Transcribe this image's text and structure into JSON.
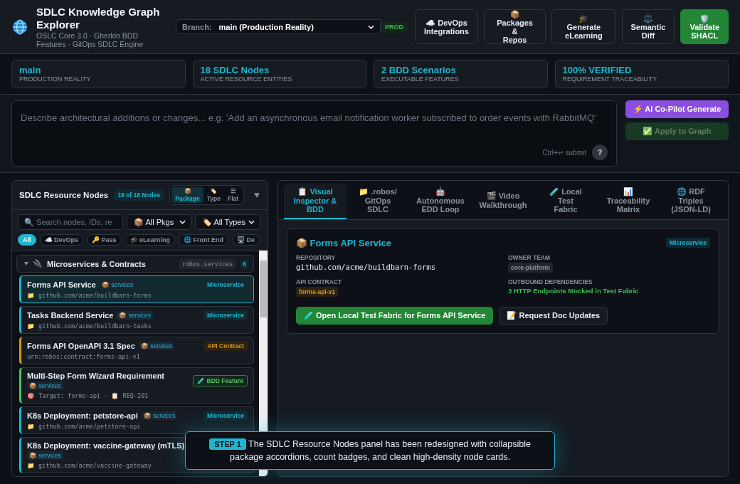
{
  "header": {
    "title": "SDLC Knowledge Graph Explorer",
    "subtitle": "OSLC Core 3.0 · Gherkin BDD Features · GitOps SDLC Engine",
    "branch_label": "Branch:",
    "branch_value": "main (Production Reality)",
    "env_badge": "PROD",
    "buttons": [
      {
        "label": "☁️ DevOps\nIntegrations",
        "kind": "plain"
      },
      {
        "label": "📦\nPackages &\nRepos",
        "kind": "plain"
      },
      {
        "label": "🎓 Generate\neLearning",
        "kind": "plain"
      },
      {
        "label": "⚖️\nSemantic\nDiff",
        "kind": "plain"
      },
      {
        "label": "🛡️\nValidate\nSHACL",
        "kind": "primary"
      }
    ]
  },
  "stats": [
    {
      "value": "main",
      "label": "PRODUCTION REALITY"
    },
    {
      "value": "18 SDLC Nodes",
      "label": "ACTIVE RESOURCE ENTITIES"
    },
    {
      "value": "2 BDD Scenarios",
      "label": "EXECUTABLE FEATURES"
    },
    {
      "value": "100% VERIFIED",
      "label": "REQUIREMENT TRACEABILITY"
    }
  ],
  "prompt": {
    "placeholder": "Describe architectural additions or changes... e.g. 'Add an asynchronous email notification worker subscribed to order events with RabbitMQ'",
    "hint": "Ctrl+↵ submit",
    "help": "?",
    "generate": "⚡ AI Co-Pilot Generate",
    "apply": "✅ Apply to Graph",
    "apply_disabled": true
  },
  "nodes_panel": {
    "title": "SDLC Resource Nodes",
    "count": "18 of 18 Nodes",
    "views": [
      {
        "icon": "📦",
        "label": "Package",
        "selected": true
      },
      {
        "icon": "🏷️",
        "label": "Type",
        "selected": false
      },
      {
        "icon": "☰",
        "label": "Flat",
        "selected": false
      }
    ],
    "search": {
      "placeholder": "🔍 Search nodes, IDs, re"
    },
    "package_filter": "📦 All Pkgs",
    "type_filter": "🏷️ All Types",
    "chips": [
      {
        "label": "All",
        "selected": true
      },
      {
        "label": "☁️ DevOps",
        "selected": false
      },
      {
        "label": "🔑 Pass",
        "selected": false
      },
      {
        "label": "🎓 eLearning",
        "selected": false
      },
      {
        "label": "🌐 Front End",
        "selected": false
      },
      {
        "label": "🖥️ De",
        "selected": false
      }
    ],
    "groups": [
      {
        "icon": "🔌",
        "name": "Microservices & Contracts",
        "package": "robos.services",
        "count": "6",
        "expanded": true,
        "nodes": [
          {
            "title": "Forms API Service",
            "package": "📦 services",
            "type": "Microservice",
            "kind": "microservice",
            "sub": "📁 github.com/acme/buildbarn-forms",
            "selected": true
          },
          {
            "title": "Tasks Backend Service",
            "package": "📦 services",
            "type": "Microservice",
            "kind": "microservice",
            "sub": "📁 github.com/acme/buildbarn-tasks",
            "selected": false
          },
          {
            "title": "Forms API OpenAPI 3.1 Spec",
            "package": "📦 services",
            "type": "API Contract",
            "kind": "contract",
            "sub": "urn:robos:contract:forms-api-v1",
            "selected": false
          },
          {
            "title": "Multi-Step Form Wizard Requirement",
            "package": "📦 services",
            "type": "🧪 BDD Feature",
            "kind": "feature",
            "sub": "🎯 Target: forms-api · 📋 REQ-201",
            "selected": false
          },
          {
            "title": "K8s Deployment: petstore-api",
            "package": "📦 services",
            "type": "Microservice",
            "kind": "microservice",
            "sub": "📁 github.com/acme/petstore-api",
            "selected": false
          },
          {
            "title": "K8s Deployment: vaccine-gateway (mTLS)",
            "package": "📦 services",
            "kind": "microservice",
            "sub": "📁 github.com/acme/vaccine-gateway",
            "selected": false
          }
        ]
      }
    ]
  },
  "inspector": {
    "tabs": [
      {
        "label": "📋 Visual\nInspector &\nBDD",
        "selected": true
      },
      {
        "label": "📁 .robos/\nGitOps\nSDLC",
        "selected": false
      },
      {
        "label": "🤖\nAutonomous\nEDD Loop",
        "selected": false
      },
      {
        "label": "🎬 Video\nWalkthrough",
        "selected": false
      },
      {
        "label": "🧪 Local\nTest\nFabric",
        "selected": false
      },
      {
        "label": "📊\nTraceability\nMatrix",
        "selected": false
      },
      {
        "label": "🌐 RDF\nTriples\n(JSON-LD)",
        "selected": false
      }
    ],
    "detail": {
      "title": "📦 Forms API Service",
      "type": "Microservice",
      "fields": [
        {
          "label": "REPOSITORY",
          "value": "github.com/acme/buildbarn-forms",
          "kind": "mono"
        },
        {
          "label": "OWNER TEAM",
          "value": "core-platform",
          "kind": "tag"
        },
        {
          "label": "API CONTRACT",
          "value": "forms-api-v1",
          "kind": "contract"
        },
        {
          "label": "OUTBOUND DEPENDENCIES",
          "value": "3 HTTP Endpoints Mocked in Test Fabric",
          "kind": "success"
        }
      ],
      "buttons": [
        {
          "label": "🧪 Open Local Test Fabric for Forms API Service",
          "kind": "primary"
        },
        {
          "label": "📝 Request Doc Updates",
          "kind": "plain"
        }
      ]
    }
  },
  "tour": {
    "step": "STEP 1",
    "text": "The SDLC Resource Nodes panel has been redesigned with collapsible package accordions, count badges, and clean high-density node cards."
  }
}
